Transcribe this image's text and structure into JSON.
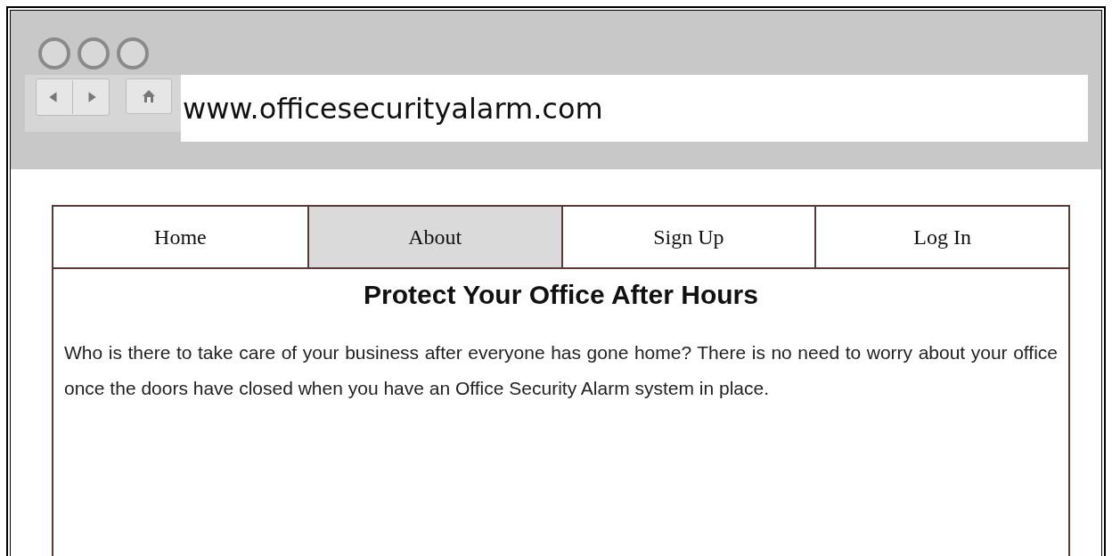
{
  "browser": {
    "url": "www.officesecurityalarm.com"
  },
  "nav": [
    {
      "label": "Home",
      "selected": false
    },
    {
      "label": "About",
      "selected": true
    },
    {
      "label": "Sign Up",
      "selected": false
    },
    {
      "label": "Log In",
      "selected": false
    }
  ],
  "content": {
    "heading": "Protect Your Office After Hours",
    "paragraph": "Who is there to take care of your business after everyone has gone home? There is no need to worry about your office once the doors have closed when you have an Office Security Alarm system in place."
  }
}
